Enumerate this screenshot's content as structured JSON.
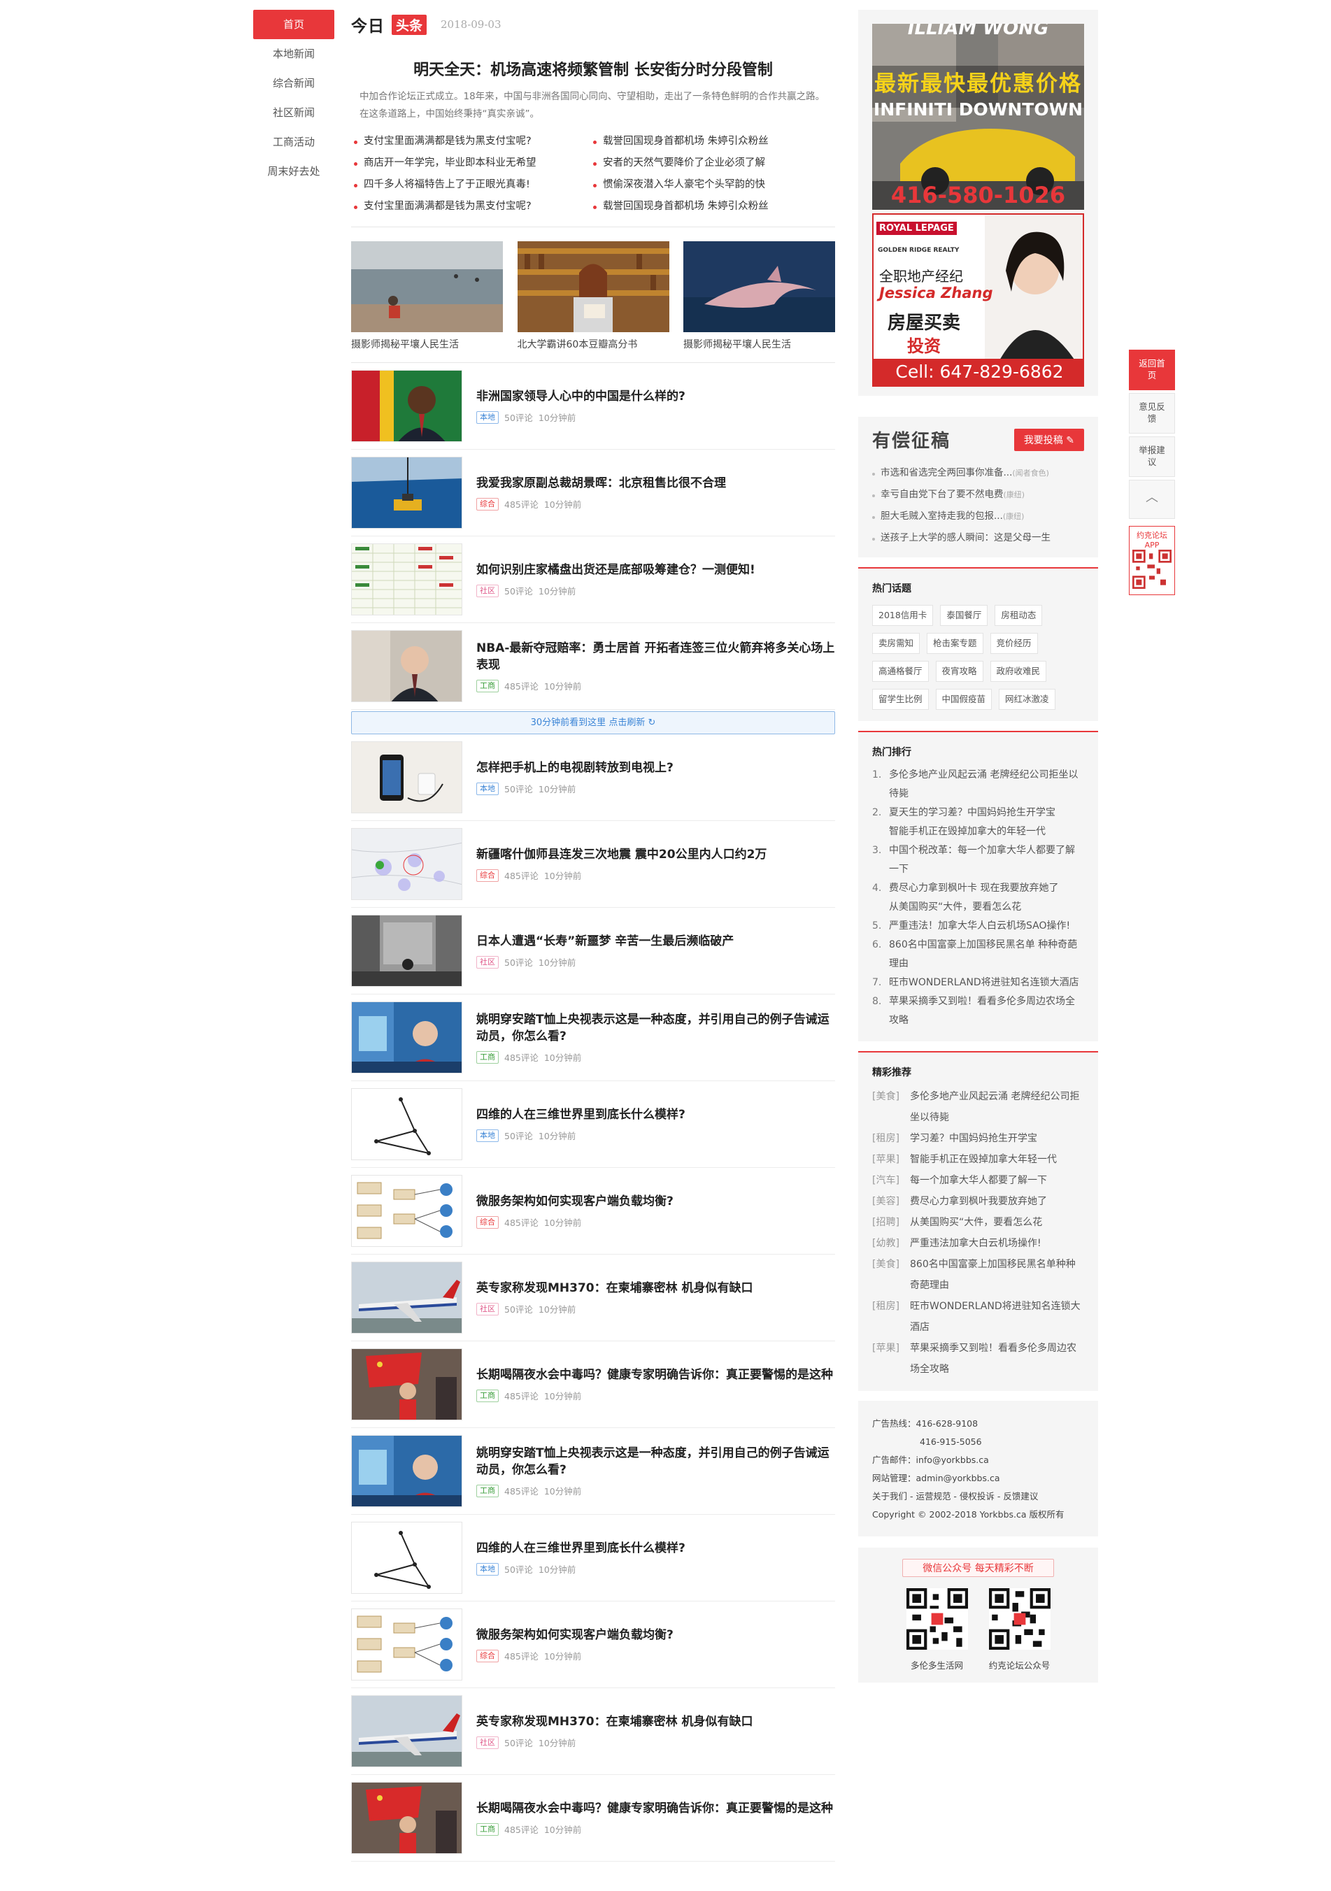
{
  "nav": {
    "items": [
      {
        "label": "首页",
        "active": true
      },
      {
        "label": "本地新闻"
      },
      {
        "label": "综合新闻"
      },
      {
        "label": "社区新闻"
      },
      {
        "label": "工商活动"
      },
      {
        "label": "周末好去处"
      }
    ]
  },
  "today": {
    "jin": "今日",
    "tou": "头条",
    "date": "2018-09-03"
  },
  "headline": {
    "title": "明天全天：机场高速将频繁管制 长安街分时分段管制",
    "lead": "中加合作论坛正式成立。18年来，中国与非洲各国同心同向、守望相助，走出了一条特色鲜明的合作共赢之路。在这条道路上，中国始终秉持“真实亲诚”。"
  },
  "toplinks": [
    "支付宝里面满满都是钱为黑支付宝呢?",
    "载誉回国现身首都机场 朱婷引众粉丝",
    "商店开一年学完，毕业即本科业无希望",
    "安者的天然气要降价了企业必须了解",
    "四千多人将福特告上了于正眼光真毒!",
    "惯偷深夜潜入华人豪宅个头罕韵的快",
    "支付宝里面满满都是钱为黑支付宝呢?",
    "载誉回国现身首都机场 朱婷引众粉丝"
  ],
  "photos": [
    {
      "caption": "摄影师揭秘平壤人民生活"
    },
    {
      "caption": "北大学霸讲60本豆瓣高分书"
    },
    {
      "caption": "摄影师揭秘平壤人民生活"
    }
  ],
  "news_a": [
    {
      "title": "非洲国家领导人心中的中国是什么样的?",
      "tag": "本地",
      "comments": "50评论",
      "time": "10分钟前"
    },
    {
      "title": "我爱我家原副总裁胡景晖：北京租售比很不合理",
      "tag": "综合",
      "comments": "485评论",
      "time": "10分钟前"
    },
    {
      "title": "如何识别庄家橘盘出货还是底部吸筹建仓？一测便知!",
      "tag": "社区",
      "comments": "50评论",
      "time": "10分钟前"
    },
    {
      "title": "NBA-最新夺冠赔率：勇士居首 开拓者连签三位火箭弃将多关心场上表现",
      "tag": "工商",
      "comments": "485评论",
      "time": "10分钟前"
    }
  ],
  "refresh": "30分钟前看到这里 点击刷新 ↻",
  "news_b": [
    {
      "title": "怎样把手机上的电视剧转放到电视上?",
      "tag": "本地",
      "comments": "50评论",
      "time": "10分钟前"
    },
    {
      "title": "新疆喀什伽师县连发三次地震 震中20公里内人口约2万",
      "tag": "综合",
      "comments": "485评论",
      "time": "10分钟前"
    },
    {
      "title": "日本人遭遇“长寿”新噩梦 辛苦一生最后濒临破产",
      "tag": "社区",
      "comments": "50评论",
      "time": "10分钟前"
    },
    {
      "title": "姚明穿安踏T恤上央视表示这是一种态度，并引用自己的例子告诫运动员，你怎么看?",
      "tag": "工商",
      "comments": "485评论",
      "time": "10分钟前"
    },
    {
      "title": "四维的人在三维世界里到底长什么模样?",
      "tag": "本地",
      "comments": "50评论",
      "time": "10分钟前"
    },
    {
      "title": "微服务架构如何实现客户端负载均衡?",
      "tag": "综合",
      "comments": "485评论",
      "time": "10分钟前"
    },
    {
      "title": "英专家称发现MH370：在柬埔寨密林 机身似有缺口",
      "tag": "社区",
      "comments": "50评论",
      "time": "10分钟前"
    },
    {
      "title": "长期喝隔夜水会中毒吗？健康专家明确告诉你：真正要警惕的是这种",
      "tag": "工商",
      "comments": "485评论",
      "time": "10分钟前"
    },
    {
      "title": "姚明穿安踏T恤上央视表示这是一种态度，并引用自己的例子告诫运动员，你怎么看?",
      "tag": "工商",
      "comments": "485评论",
      "time": "10分钟前"
    },
    {
      "title": "四维的人在三维世界里到底长什么模样?",
      "tag": "本地",
      "comments": "50评论",
      "time": "10分钟前"
    },
    {
      "title": "微服务架构如何实现客户端负载均衡?",
      "tag": "综合",
      "comments": "485评论",
      "time": "10分钟前"
    },
    {
      "title": "英专家称发现MH370：在柬埔寨密林 机身似有缺口",
      "tag": "社区",
      "comments": "50评论",
      "time": "10分钟前"
    },
    {
      "title": "长期喝隔夜水会中毒吗？健康专家明确告诉你：真正要警惕的是这种",
      "tag": "工商",
      "comments": "485评论",
      "time": "10分钟前"
    }
  ],
  "ad1": {
    "line1": "ILLIAM WONG",
    "line2": "最新最快最优惠价格",
    "line3": "INFINITI DOWNTOWN",
    "phone": "416-580-1026"
  },
  "ad2": {
    "brand": "ROYAL LEPAGE",
    "sub": "GOLDEN RIDGE REALTY",
    "role": "全职地产经纪",
    "name": "Jessica Zhang",
    "slogan1": "房屋买卖",
    "slogan2": "投资",
    "cell": "Cell: 647-829-6862"
  },
  "tougao": {
    "title": "有偿征稿",
    "button": "我要投稿 ✎",
    "items": [
      {
        "text": "市选和省选完全两回事你准备...",
        "note": "(闻者食色)"
      },
      {
        "text": "幸亏自由党下台了要不然电费",
        "note": "(康纽)"
      },
      {
        "text": "胆大毛贼入室持走我的包报...",
        "note": "(康纽)"
      },
      {
        "text": "送孩子上大学的感人瞬间：这是父母一生",
        "note": ""
      }
    ]
  },
  "hot_topics": {
    "title": "热门话题",
    "tags": [
      "2018信用卡",
      "泰国餐厅",
      "房租动态",
      "卖房需知",
      "枪击案专题",
      "竞价经历",
      "高通格餐厅",
      "夜宵攻略",
      "政府收难民",
      "留学生比例",
      "中国假疫苗",
      "网红冰激凌"
    ]
  },
  "hot_rank": {
    "title": "热门排行",
    "items": [
      "多伦多地产业风起云涌 老牌经纪公司拒坐以待毙",
      "夏天生的学习差？中国妈妈抢生开学宝",
      "智能手机正在毁掉加拿大的年轻一代",
      "中国个税改革：每一个加拿大华人都要了解一下",
      "费尽心力拿到枫叶卡 现在我要放弃她了",
      "从美国购买“大件，要看怎么花",
      "严重违法！加拿大华人白云机场SAO操作!",
      "860名中国富豪上加国移民黑名单 种种奇葩理由",
      "旺市WONDERLAND将进驻知名连锁大酒店",
      "苹果采摘季又到啦！看看多伦多周边农场全攻略"
    ],
    "numbers": [
      "1.",
      "2.",
      "3.",
      "4.",
      "5.",
      "6.",
      "7.",
      "8."
    ]
  },
  "recommend": {
    "title": "精彩推荐",
    "items": [
      {
        "cat": "[美食]",
        "text": "多伦多地产业风起云涌 老牌经纪公司拒坐以待毙"
      },
      {
        "cat": "[租房]",
        "text": "学习差？中国妈妈抢生开学宝"
      },
      {
        "cat": "[苹果]",
        "text": "智能手机正在毁掉加拿大年轻一代"
      },
      {
        "cat": "[汽车]",
        "text": "每一个加拿大华人都要了解一下"
      },
      {
        "cat": "[美容]",
        "text": "费尽心力拿到枫叶我要放弃她了"
      },
      {
        "cat": "[招聘]",
        "text": "从美国购买“大件，要看怎么花"
      },
      {
        "cat": "[幼教]",
        "text": "严重违法加拿大白云机场操作!"
      },
      {
        "cat": "[美食]",
        "text": "860名中国富豪上加国移民黑名单种种奇葩理由"
      },
      {
        "cat": "[租房]",
        "text": "旺市WONDERLAND将进驻知名连锁大酒店"
      },
      {
        "cat": "[苹果]",
        "text": "苹果采摘季又到啦！看看多伦多周边农场全攻略"
      }
    ]
  },
  "contact": {
    "hotline_label": "广告热线：",
    "hotline1": "416-628-9108",
    "hotline2": "416-915-5056",
    "email_label": "广告邮件：",
    "email": "info@yorkbbs.ca",
    "admin_label": "网站管理：",
    "admin": "admin@yorkbbs.ca",
    "links": "关于我们 - 运营规范 - 侵权投诉 - 反馈建议",
    "copyright": "Copyright © 2002-2018 Yorkbbs.ca 版权所有"
  },
  "wechat": {
    "badge": "微信公众号 每天精彩不断",
    "qr1": "多伦多生活网",
    "qr2": "约克论坛公众号"
  },
  "floatbar": {
    "home": "返回首页",
    "feedback": "意见反馈",
    "report": "举报建议",
    "up": "︿",
    "app": "约克论坛APP"
  },
  "icons": [
    "edit-icon",
    "refresh-icon",
    "up-arrow-icon",
    "qr-code-icon"
  ],
  "colors": {
    "accent": "#e8373a",
    "link_blue": "#3a84d6"
  }
}
